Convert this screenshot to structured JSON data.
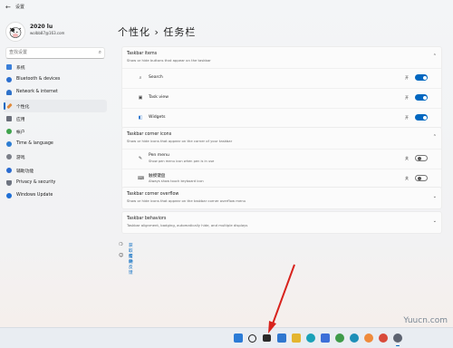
{
  "window": {
    "app_title": "设置",
    "back_icon": "back-arrow-icon"
  },
  "account": {
    "name": "2020 lu",
    "email": "wolbb87@163.com"
  },
  "search": {
    "placeholder": "查找设置",
    "icon": "search-icon"
  },
  "sidebar": {
    "items": [
      {
        "label": "系统",
        "icon": "monitor-icon",
        "color": "#3b7fd9"
      },
      {
        "label": "Bluetooth & devices",
        "icon": "bluetooth-icon",
        "color": "#2c6fcf"
      },
      {
        "label": "Network & internet",
        "icon": "wifi-icon",
        "color": "#2f72c9"
      },
      {
        "label": "个性化",
        "icon": "brush-icon",
        "color": "#e08a3a",
        "active": true
      },
      {
        "label": "应用",
        "icon": "apps-icon",
        "color": "#6b6f7a"
      },
      {
        "label": "帐户",
        "icon": "person-icon",
        "color": "#3fa34d"
      },
      {
        "label": "Time & language",
        "icon": "globe-clock-icon",
        "color": "#2d7dd2"
      },
      {
        "label": "游戏",
        "icon": "gamepad-icon",
        "color": "#7b7f88"
      },
      {
        "label": "辅助功能",
        "icon": "accessibility-icon",
        "color": "#2a6bd0"
      },
      {
        "label": "Privacy & security",
        "icon": "shield-icon",
        "color": "#6e7480"
      },
      {
        "label": "Windows Update",
        "icon": "update-icon",
        "color": "#1f6fd6"
      }
    ]
  },
  "main": {
    "breadcrumb_parent": "个性化",
    "breadcrumb_sep": "›",
    "breadcrumb_current": "任务栏",
    "sections": {
      "items": {
        "title": "Taskbar items",
        "subtitle": "Show or hide buttons that appear on the taskbar",
        "rows": [
          {
            "label": "Search",
            "icon": "search-icon",
            "state": "开",
            "on": true
          },
          {
            "label": "Task view",
            "icon": "task-view-icon",
            "state": "开",
            "on": true
          },
          {
            "label": "Widgets",
            "icon": "widgets-icon",
            "state": "开",
            "on": true
          }
        ]
      },
      "corner_icons": {
        "title": "Taskbar corner icons",
        "subtitle": "Show or hide icons that appear on the corner of your taskbar",
        "rows": [
          {
            "label": "Pen menu",
            "sub": "Show pen menu icon when pen is in use",
            "icon": "pen-icon",
            "state": "关",
            "on": false
          },
          {
            "label": "触摸键盘",
            "sub": "Always show touch keyboard icon",
            "icon": "keyboard-icon",
            "state": "关",
            "on": false
          }
        ]
      },
      "overflow": {
        "title": "Taskbar corner overflow",
        "subtitle": "Show or hide icons that appear on the taskbar corner overflow menu"
      },
      "behaviors": {
        "title": "Taskbar behaviors",
        "subtitle": "Taskbar alignment, badging, automatically hide, and multiple displays"
      }
    },
    "links": [
      {
        "label": "获取帮助",
        "icon": "help-icon"
      },
      {
        "label": "提供反馈",
        "icon": "feedback-icon"
      }
    ]
  },
  "taskbar": {
    "icons": [
      {
        "name": "start-icon",
        "color": "#2b7bd6"
      },
      {
        "name": "search-icon",
        "color": "#1f1f1f"
      },
      {
        "name": "task-view-icon",
        "color": "#2a2a2a"
      },
      {
        "name": "widgets-icon",
        "color": "#2f77cf"
      },
      {
        "name": "file-explorer-icon",
        "color": "#e4b530"
      },
      {
        "name": "edge-icon",
        "color": "#1aa1b8"
      },
      {
        "name": "store-icon",
        "color": "#3c6fd8"
      },
      {
        "name": "browser-icon",
        "color": "#3f9b4a"
      },
      {
        "name": "edge-beta-icon",
        "color": "#1d8fb8"
      },
      {
        "name": "app-icon",
        "color": "#ef8b3c"
      },
      {
        "name": "chrome-icon",
        "color": "#d84a3a"
      },
      {
        "name": "settings-icon",
        "color": "#5d6370",
        "active": true
      }
    ]
  },
  "watermark": "Yuucn.com",
  "annotation_color": "#d8231d"
}
